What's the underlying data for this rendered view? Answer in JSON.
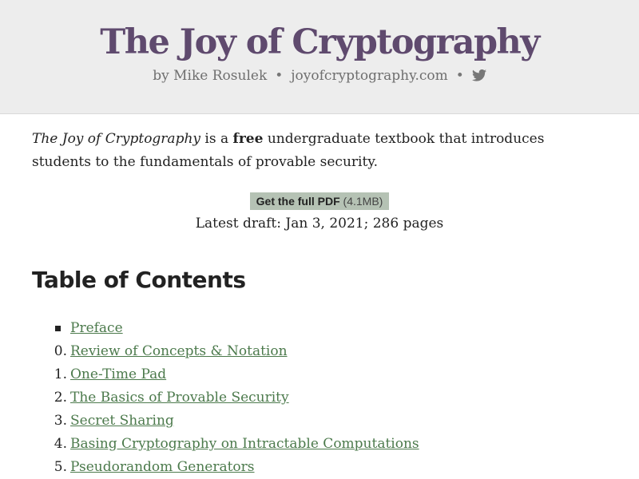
{
  "header": {
    "title": "The Joy of Cryptography",
    "author": "by Mike Rosulek",
    "separator": "•",
    "website": "joyofcryptography.com",
    "twitter_icon": "twitter-bird-icon"
  },
  "intro": {
    "book_title": "The Joy of Cryptography",
    "text_1": " is a ",
    "free": "free",
    "text_2": " undergraduate textbook that introduces students to the fundamentals of provable security."
  },
  "pdf": {
    "label": "Get the full PDF",
    "size": " (4.1MB)"
  },
  "draft": "Latest draft: Jan 3, 2021; 286 pages",
  "toc": {
    "heading": "Table of Contents",
    "items": [
      {
        "num": "",
        "title": "Preface"
      },
      {
        "num": "0.",
        "title": "Review of Concepts & Notation"
      },
      {
        "num": "1.",
        "title": "One-Time Pad"
      },
      {
        "num": "2.",
        "title": "The Basics of Provable Security"
      },
      {
        "num": "3.",
        "title": "Secret Sharing"
      },
      {
        "num": "4.",
        "title": "Basing Cryptography on Intractable Computations"
      },
      {
        "num": "5.",
        "title": "Pseudorandom Generators"
      }
    ]
  },
  "colors": {
    "title": "#5f4a6e",
    "link": "#4c7a4c",
    "header_bg": "#ededed",
    "pdf_button_bg": "#b5c2b4"
  }
}
